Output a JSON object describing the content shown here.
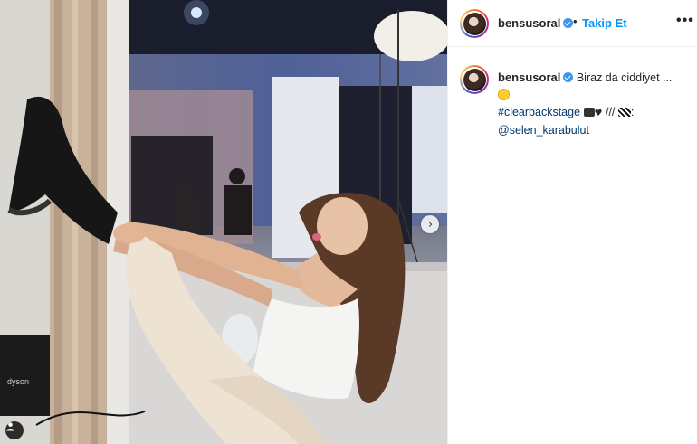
{
  "post": {
    "photo": {
      "next_icon": "chevron-right-icon",
      "tag_icon": "user-tag-icon",
      "brand_text": "dyson"
    },
    "header": {
      "username": "bensusoral",
      "verified_icon": "verified-badge-icon",
      "separator": "•",
      "follow_label": "Takip Et",
      "more_icon": "more-options-icon",
      "more_label": "•••"
    },
    "caption": {
      "username": "bensusoral",
      "text": "Biraz da ciddiyet ...",
      "hashtag": "#clearbackstage",
      "separator": "///",
      "colon": ":",
      "mention": "@selen_karabulut",
      "heart": "♥"
    }
  },
  "colors": {
    "link_blue": "#0095f6",
    "hashtag_blue": "#00376b",
    "verified_blue": "#3897f0",
    "text": "#262626",
    "border": "#efefef"
  }
}
